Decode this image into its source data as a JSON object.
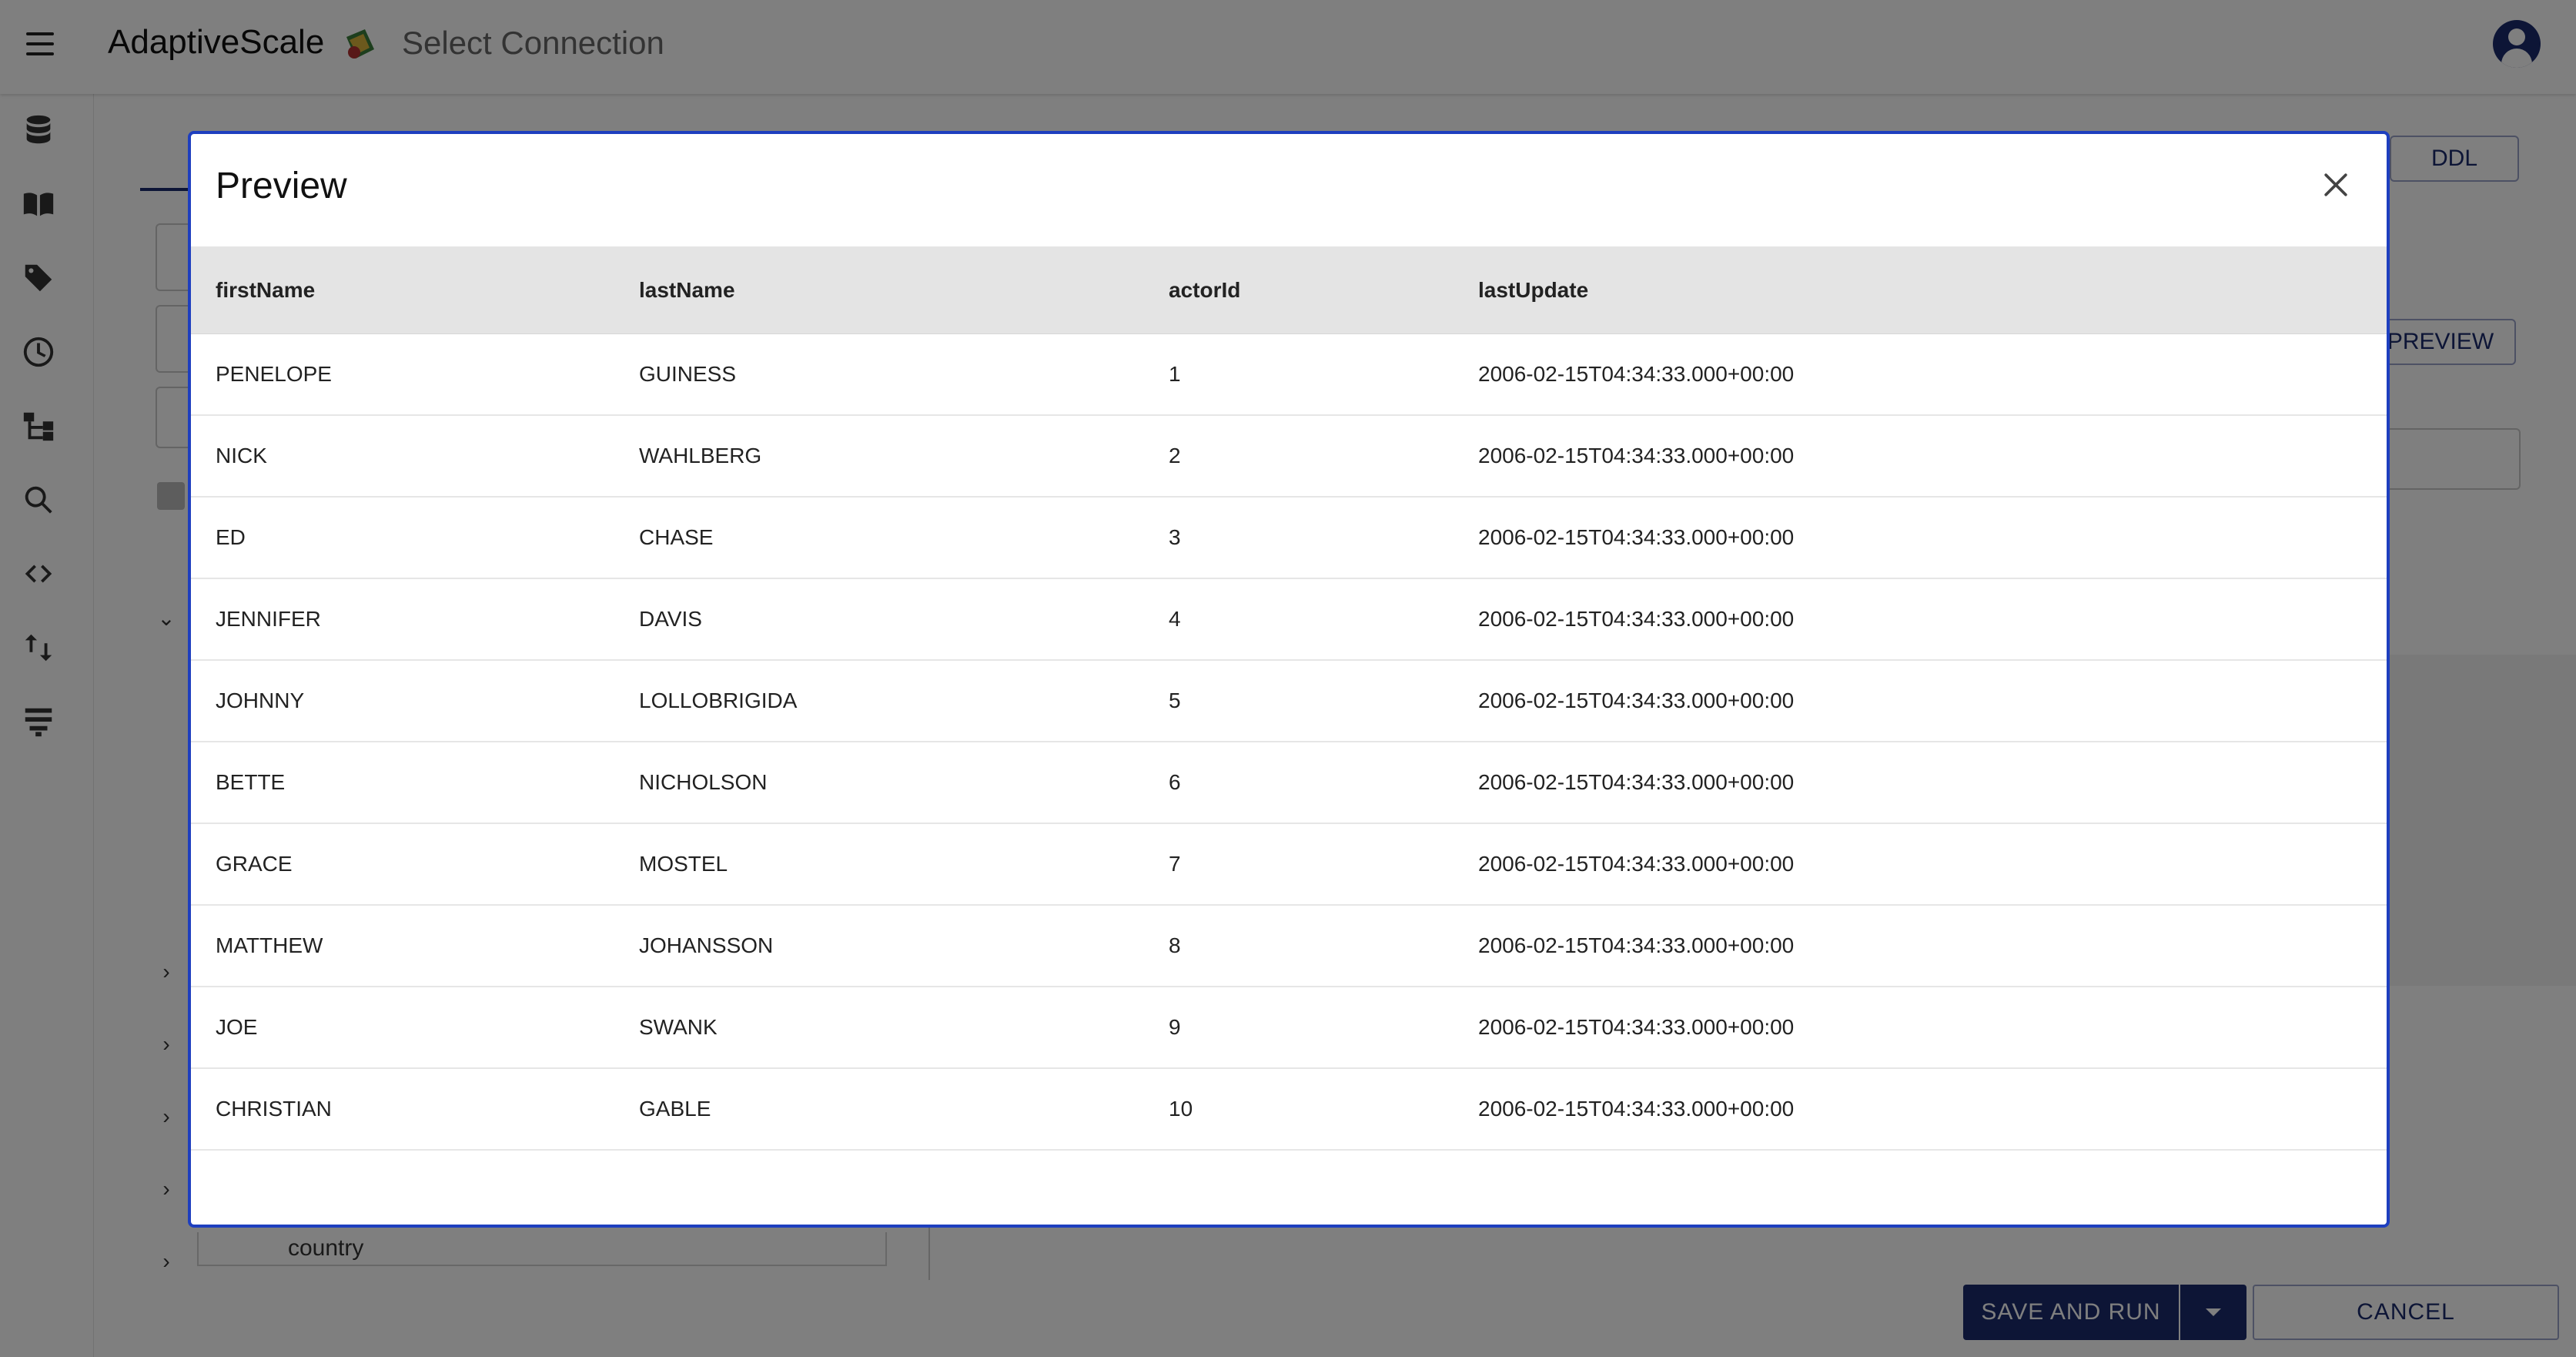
{
  "header": {
    "app_name": "AdaptiveScale",
    "page_title": "Select Connection"
  },
  "sidebar": {
    "icons": [
      "database-icon",
      "book-icon",
      "tag-icon",
      "history-icon",
      "hierarchy-icon",
      "search-icon",
      "code-icon",
      "swap-vertical-icon",
      "lineage-icon"
    ]
  },
  "background": {
    "ddl_label": "DDL",
    "preview_label": "PREVIEW",
    "country_label": "country",
    "save_run_label": "SAVE AND RUN",
    "cancel_label": "CANCEL"
  },
  "dialog": {
    "title": "Preview",
    "columns": [
      "firstName",
      "lastName",
      "actorId",
      "lastUpdate"
    ],
    "rows": [
      [
        "PENELOPE",
        "GUINESS",
        "1",
        "2006-02-15T04:34:33.000+00:00"
      ],
      [
        "NICK",
        "WAHLBERG",
        "2",
        "2006-02-15T04:34:33.000+00:00"
      ],
      [
        "ED",
        "CHASE",
        "3",
        "2006-02-15T04:34:33.000+00:00"
      ],
      [
        "JENNIFER",
        "DAVIS",
        "4",
        "2006-02-15T04:34:33.000+00:00"
      ],
      [
        "JOHNNY",
        "LOLLOBRIGIDA",
        "5",
        "2006-02-15T04:34:33.000+00:00"
      ],
      [
        "BETTE",
        "NICHOLSON",
        "6",
        "2006-02-15T04:34:33.000+00:00"
      ],
      [
        "GRACE",
        "MOSTEL",
        "7",
        "2006-02-15T04:34:33.000+00:00"
      ],
      [
        "MATTHEW",
        "JOHANSSON",
        "8",
        "2006-02-15T04:34:33.000+00:00"
      ],
      [
        "JOE",
        "SWANK",
        "9",
        "2006-02-15T04:34:33.000+00:00"
      ],
      [
        "CHRISTIAN",
        "GABLE",
        "10",
        "2006-02-15T04:34:33.000+00:00"
      ]
    ]
  },
  "colors": {
    "primary": "#1a2a6c",
    "dialog_border": "#1e3fbf",
    "header_bg": "#e4e4e4",
    "backdrop": "rgba(0,0,0,0.5)"
  }
}
